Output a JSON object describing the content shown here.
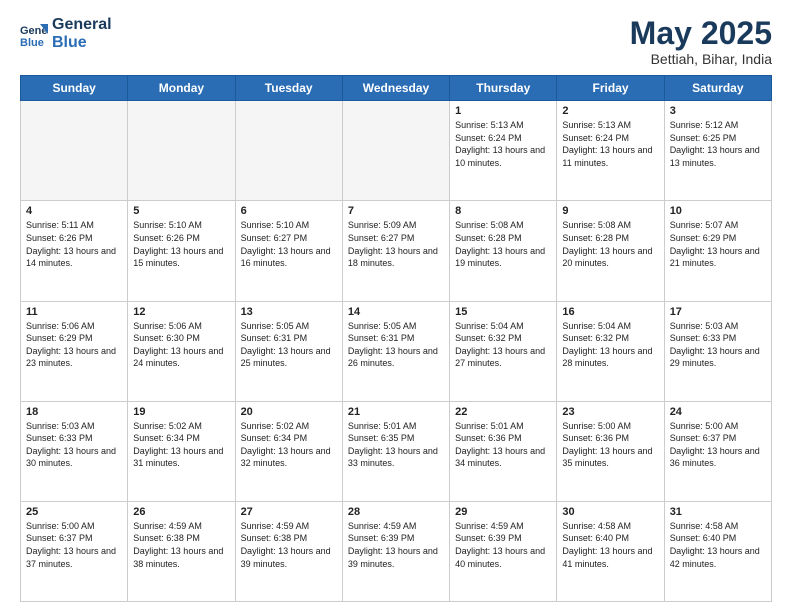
{
  "header": {
    "logo_line1": "General",
    "logo_line2": "Blue",
    "month": "May 2025",
    "location": "Bettiah, Bihar, India"
  },
  "weekdays": [
    "Sunday",
    "Monday",
    "Tuesday",
    "Wednesday",
    "Thursday",
    "Friday",
    "Saturday"
  ],
  "weeks": [
    [
      {
        "day": "",
        "empty": true
      },
      {
        "day": "",
        "empty": true
      },
      {
        "day": "",
        "empty": true
      },
      {
        "day": "",
        "empty": true
      },
      {
        "day": "1",
        "sunrise": "5:13 AM",
        "sunset": "6:24 PM",
        "daylight": "13 hours and 10 minutes."
      },
      {
        "day": "2",
        "sunrise": "5:13 AM",
        "sunset": "6:24 PM",
        "daylight": "13 hours and 11 minutes."
      },
      {
        "day": "3",
        "sunrise": "5:12 AM",
        "sunset": "6:25 PM",
        "daylight": "13 hours and 13 minutes."
      }
    ],
    [
      {
        "day": "4",
        "sunrise": "5:11 AM",
        "sunset": "6:26 PM",
        "daylight": "13 hours and 14 minutes."
      },
      {
        "day": "5",
        "sunrise": "5:10 AM",
        "sunset": "6:26 PM",
        "daylight": "13 hours and 15 minutes."
      },
      {
        "day": "6",
        "sunrise": "5:10 AM",
        "sunset": "6:27 PM",
        "daylight": "13 hours and 16 minutes."
      },
      {
        "day": "7",
        "sunrise": "5:09 AM",
        "sunset": "6:27 PM",
        "daylight": "13 hours and 18 minutes."
      },
      {
        "day": "8",
        "sunrise": "5:08 AM",
        "sunset": "6:28 PM",
        "daylight": "13 hours and 19 minutes."
      },
      {
        "day": "9",
        "sunrise": "5:08 AM",
        "sunset": "6:28 PM",
        "daylight": "13 hours and 20 minutes."
      },
      {
        "day": "10",
        "sunrise": "5:07 AM",
        "sunset": "6:29 PM",
        "daylight": "13 hours and 21 minutes."
      }
    ],
    [
      {
        "day": "11",
        "sunrise": "5:06 AM",
        "sunset": "6:29 PM",
        "daylight": "13 hours and 23 minutes."
      },
      {
        "day": "12",
        "sunrise": "5:06 AM",
        "sunset": "6:30 PM",
        "daylight": "13 hours and 24 minutes."
      },
      {
        "day": "13",
        "sunrise": "5:05 AM",
        "sunset": "6:31 PM",
        "daylight": "13 hours and 25 minutes."
      },
      {
        "day": "14",
        "sunrise": "5:05 AM",
        "sunset": "6:31 PM",
        "daylight": "13 hours and 26 minutes."
      },
      {
        "day": "15",
        "sunrise": "5:04 AM",
        "sunset": "6:32 PM",
        "daylight": "13 hours and 27 minutes."
      },
      {
        "day": "16",
        "sunrise": "5:04 AM",
        "sunset": "6:32 PM",
        "daylight": "13 hours and 28 minutes."
      },
      {
        "day": "17",
        "sunrise": "5:03 AM",
        "sunset": "6:33 PM",
        "daylight": "13 hours and 29 minutes."
      }
    ],
    [
      {
        "day": "18",
        "sunrise": "5:03 AM",
        "sunset": "6:33 PM",
        "daylight": "13 hours and 30 minutes."
      },
      {
        "day": "19",
        "sunrise": "5:02 AM",
        "sunset": "6:34 PM",
        "daylight": "13 hours and 31 minutes."
      },
      {
        "day": "20",
        "sunrise": "5:02 AM",
        "sunset": "6:34 PM",
        "daylight": "13 hours and 32 minutes."
      },
      {
        "day": "21",
        "sunrise": "5:01 AM",
        "sunset": "6:35 PM",
        "daylight": "13 hours and 33 minutes."
      },
      {
        "day": "22",
        "sunrise": "5:01 AM",
        "sunset": "6:36 PM",
        "daylight": "13 hours and 34 minutes."
      },
      {
        "day": "23",
        "sunrise": "5:00 AM",
        "sunset": "6:36 PM",
        "daylight": "13 hours and 35 minutes."
      },
      {
        "day": "24",
        "sunrise": "5:00 AM",
        "sunset": "6:37 PM",
        "daylight": "13 hours and 36 minutes."
      }
    ],
    [
      {
        "day": "25",
        "sunrise": "5:00 AM",
        "sunset": "6:37 PM",
        "daylight": "13 hours and 37 minutes."
      },
      {
        "day": "26",
        "sunrise": "4:59 AM",
        "sunset": "6:38 PM",
        "daylight": "13 hours and 38 minutes."
      },
      {
        "day": "27",
        "sunrise": "4:59 AM",
        "sunset": "6:38 PM",
        "daylight": "13 hours and 39 minutes."
      },
      {
        "day": "28",
        "sunrise": "4:59 AM",
        "sunset": "6:39 PM",
        "daylight": "13 hours and 39 minutes."
      },
      {
        "day": "29",
        "sunrise": "4:59 AM",
        "sunset": "6:39 PM",
        "daylight": "13 hours and 40 minutes."
      },
      {
        "day": "30",
        "sunrise": "4:58 AM",
        "sunset": "6:40 PM",
        "daylight": "13 hours and 41 minutes."
      },
      {
        "day": "31",
        "sunrise": "4:58 AM",
        "sunset": "6:40 PM",
        "daylight": "13 hours and 42 minutes."
      }
    ]
  ]
}
